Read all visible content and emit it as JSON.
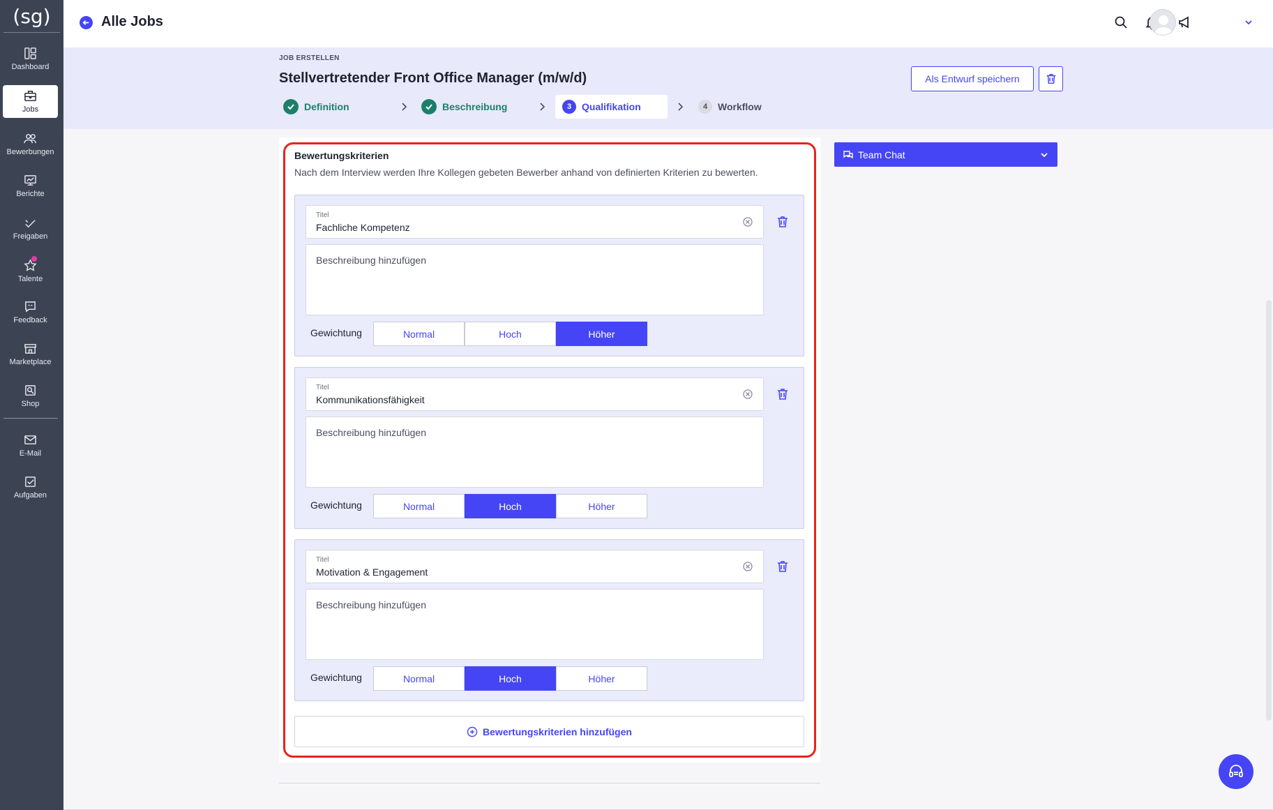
{
  "app": {
    "logo_text": "(sg)",
    "accent_color": "#4545f5",
    "success_color": "#1c7f6c",
    "highlight_color": "#e8231c"
  },
  "sidebar": {
    "items": [
      {
        "label": "Dashboard",
        "icon": "dashboard-icon"
      },
      {
        "label": "Jobs",
        "icon": "briefcase-icon",
        "active": true
      },
      {
        "label": "Bewerbungen",
        "icon": "users-icon"
      },
      {
        "label": "Berichte",
        "icon": "chart-icon"
      },
      {
        "label": "Freigaben",
        "icon": "approval-icon"
      },
      {
        "label": "Talente",
        "icon": "star-icon"
      },
      {
        "label": "Feedback",
        "icon": "feedback-icon"
      },
      {
        "label": "Marketplace",
        "icon": "store-icon"
      },
      {
        "label": "Shop",
        "icon": "shop-icon"
      },
      {
        "label": "E-Mail",
        "icon": "mail-icon"
      },
      {
        "label": "Aufgaben",
        "icon": "tasks-icon"
      }
    ]
  },
  "topbar": {
    "title": "Alle Jobs",
    "icons": [
      "search-icon",
      "bell-icon",
      "megaphone-icon",
      "avatar",
      "chevron-down-icon"
    ]
  },
  "header": {
    "overline": "JOB ERSTELLEN",
    "title": "Stellvertretender Front Office Manager (m/w/d)",
    "save_draft_label": "Als Entwurf speichern",
    "steps": [
      {
        "number": "1",
        "label": "Definition",
        "state": "done"
      },
      {
        "number": "2",
        "label": "Beschreibung",
        "state": "done"
      },
      {
        "number": "3",
        "label": "Qualifikation",
        "state": "current"
      },
      {
        "number": "4",
        "label": "Workflow",
        "state": "todo"
      }
    ]
  },
  "criteria_section": {
    "title": "Bewertungskriterien",
    "description": "Nach dem Interview werden Ihre Kollegen gebeten Bewerber anhand von definierten Kriterien zu bewerten.",
    "field_label": "Titel",
    "description_placeholder": "Beschreibung hinzufügen",
    "weight_label": "Gewichtung",
    "weight_options": [
      "Normal",
      "Hoch",
      "Höher"
    ],
    "criteria": [
      {
        "title": "Fachliche Kompetenz",
        "weight": "Höher"
      },
      {
        "title": "Kommunikationsfähigkeit",
        "weight": "Hoch"
      },
      {
        "title": "Motivation & Engagement",
        "weight": "Hoch"
      }
    ],
    "add_label": "Bewertungskriterien hinzufügen"
  },
  "team_chat": {
    "label": "Team Chat"
  }
}
